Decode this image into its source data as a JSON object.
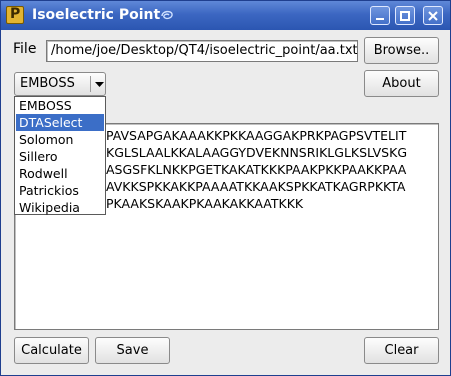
{
  "window": {
    "title": "Isoelectric Point"
  },
  "file": {
    "label": "File",
    "path": "/home/joe/Desktop/QT4/isoelectric_point/aa.txt"
  },
  "buttons": {
    "browse": "Browse..",
    "about": "About",
    "calculate": "Calculate",
    "save": "Save",
    "clear": "Clear"
  },
  "method": {
    "selected": "EMBOSS",
    "options": [
      "EMBOSS",
      "DTASelect",
      "Solomon",
      "Sillero",
      "Rodwell",
      "Patrickios",
      "Wikipedia"
    ],
    "highlighted": "DTASelect"
  },
  "sequence_lines": [
    "PAVSAPGAKAAAKKPKKAAGGAKPRKPAGPSVTELIT",
    "KGLSLAALKKALAAGGYDVEKNNSRIKLGLKSLVSKG",
    "ASGSFKLNKKPGETKAKATKKKPAAKPKKPAAKKPAA",
    "AVKKSPKKAKKPAAAATKKAAKSPKKATKAGRPKKTA",
    "PKAAKSKAAKPKAAKAKKAATKKK"
  ]
}
